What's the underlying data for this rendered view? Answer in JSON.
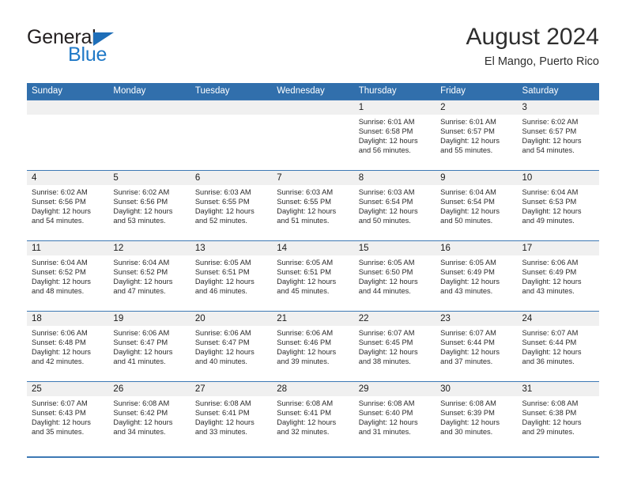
{
  "brand": {
    "name_part1": "General",
    "name_part2": "Blue",
    "accent_color": "#2079c7",
    "triangle_icon": "triangle-icon"
  },
  "header": {
    "month_title": "August 2024",
    "location": "El Mango, Puerto Rico"
  },
  "theme": {
    "header_band": "#316fac",
    "row_divider": "#3d79b4",
    "date_band": "#f0f0f0"
  },
  "weekdays": [
    "Sunday",
    "Monday",
    "Tuesday",
    "Wednesday",
    "Thursday",
    "Friday",
    "Saturday"
  ],
  "weeks": [
    [
      {
        "day": "",
        "empty": true
      },
      {
        "day": "",
        "empty": true
      },
      {
        "day": "",
        "empty": true
      },
      {
        "day": "",
        "empty": true
      },
      {
        "day": "1",
        "sunrise": "Sunrise: 6:01 AM",
        "sunset": "Sunset: 6:58 PM",
        "daylight1": "Daylight: 12 hours",
        "daylight2": "and 56 minutes."
      },
      {
        "day": "2",
        "sunrise": "Sunrise: 6:01 AM",
        "sunset": "Sunset: 6:57 PM",
        "daylight1": "Daylight: 12 hours",
        "daylight2": "and 55 minutes."
      },
      {
        "day": "3",
        "sunrise": "Sunrise: 6:02 AM",
        "sunset": "Sunset: 6:57 PM",
        "daylight1": "Daylight: 12 hours",
        "daylight2": "and 54 minutes."
      }
    ],
    [
      {
        "day": "4",
        "sunrise": "Sunrise: 6:02 AM",
        "sunset": "Sunset: 6:56 PM",
        "daylight1": "Daylight: 12 hours",
        "daylight2": "and 54 minutes."
      },
      {
        "day": "5",
        "sunrise": "Sunrise: 6:02 AM",
        "sunset": "Sunset: 6:56 PM",
        "daylight1": "Daylight: 12 hours",
        "daylight2": "and 53 minutes."
      },
      {
        "day": "6",
        "sunrise": "Sunrise: 6:03 AM",
        "sunset": "Sunset: 6:55 PM",
        "daylight1": "Daylight: 12 hours",
        "daylight2": "and 52 minutes."
      },
      {
        "day": "7",
        "sunrise": "Sunrise: 6:03 AM",
        "sunset": "Sunset: 6:55 PM",
        "daylight1": "Daylight: 12 hours",
        "daylight2": "and 51 minutes."
      },
      {
        "day": "8",
        "sunrise": "Sunrise: 6:03 AM",
        "sunset": "Sunset: 6:54 PM",
        "daylight1": "Daylight: 12 hours",
        "daylight2": "and 50 minutes."
      },
      {
        "day": "9",
        "sunrise": "Sunrise: 6:04 AM",
        "sunset": "Sunset: 6:54 PM",
        "daylight1": "Daylight: 12 hours",
        "daylight2": "and 50 minutes."
      },
      {
        "day": "10",
        "sunrise": "Sunrise: 6:04 AM",
        "sunset": "Sunset: 6:53 PM",
        "daylight1": "Daylight: 12 hours",
        "daylight2": "and 49 minutes."
      }
    ],
    [
      {
        "day": "11",
        "sunrise": "Sunrise: 6:04 AM",
        "sunset": "Sunset: 6:52 PM",
        "daylight1": "Daylight: 12 hours",
        "daylight2": "and 48 minutes."
      },
      {
        "day": "12",
        "sunrise": "Sunrise: 6:04 AM",
        "sunset": "Sunset: 6:52 PM",
        "daylight1": "Daylight: 12 hours",
        "daylight2": "and 47 minutes."
      },
      {
        "day": "13",
        "sunrise": "Sunrise: 6:05 AM",
        "sunset": "Sunset: 6:51 PM",
        "daylight1": "Daylight: 12 hours",
        "daylight2": "and 46 minutes."
      },
      {
        "day": "14",
        "sunrise": "Sunrise: 6:05 AM",
        "sunset": "Sunset: 6:51 PM",
        "daylight1": "Daylight: 12 hours",
        "daylight2": "and 45 minutes."
      },
      {
        "day": "15",
        "sunrise": "Sunrise: 6:05 AM",
        "sunset": "Sunset: 6:50 PM",
        "daylight1": "Daylight: 12 hours",
        "daylight2": "and 44 minutes."
      },
      {
        "day": "16",
        "sunrise": "Sunrise: 6:05 AM",
        "sunset": "Sunset: 6:49 PM",
        "daylight1": "Daylight: 12 hours",
        "daylight2": "and 43 minutes."
      },
      {
        "day": "17",
        "sunrise": "Sunrise: 6:06 AM",
        "sunset": "Sunset: 6:49 PM",
        "daylight1": "Daylight: 12 hours",
        "daylight2": "and 43 minutes."
      }
    ],
    [
      {
        "day": "18",
        "sunrise": "Sunrise: 6:06 AM",
        "sunset": "Sunset: 6:48 PM",
        "daylight1": "Daylight: 12 hours",
        "daylight2": "and 42 minutes."
      },
      {
        "day": "19",
        "sunrise": "Sunrise: 6:06 AM",
        "sunset": "Sunset: 6:47 PM",
        "daylight1": "Daylight: 12 hours",
        "daylight2": "and 41 minutes."
      },
      {
        "day": "20",
        "sunrise": "Sunrise: 6:06 AM",
        "sunset": "Sunset: 6:47 PM",
        "daylight1": "Daylight: 12 hours",
        "daylight2": "and 40 minutes."
      },
      {
        "day": "21",
        "sunrise": "Sunrise: 6:06 AM",
        "sunset": "Sunset: 6:46 PM",
        "daylight1": "Daylight: 12 hours",
        "daylight2": "and 39 minutes."
      },
      {
        "day": "22",
        "sunrise": "Sunrise: 6:07 AM",
        "sunset": "Sunset: 6:45 PM",
        "daylight1": "Daylight: 12 hours",
        "daylight2": "and 38 minutes."
      },
      {
        "day": "23",
        "sunrise": "Sunrise: 6:07 AM",
        "sunset": "Sunset: 6:44 PM",
        "daylight1": "Daylight: 12 hours",
        "daylight2": "and 37 minutes."
      },
      {
        "day": "24",
        "sunrise": "Sunrise: 6:07 AM",
        "sunset": "Sunset: 6:44 PM",
        "daylight1": "Daylight: 12 hours",
        "daylight2": "and 36 minutes."
      }
    ],
    [
      {
        "day": "25",
        "sunrise": "Sunrise: 6:07 AM",
        "sunset": "Sunset: 6:43 PM",
        "daylight1": "Daylight: 12 hours",
        "daylight2": "and 35 minutes."
      },
      {
        "day": "26",
        "sunrise": "Sunrise: 6:08 AM",
        "sunset": "Sunset: 6:42 PM",
        "daylight1": "Daylight: 12 hours",
        "daylight2": "and 34 minutes."
      },
      {
        "day": "27",
        "sunrise": "Sunrise: 6:08 AM",
        "sunset": "Sunset: 6:41 PM",
        "daylight1": "Daylight: 12 hours",
        "daylight2": "and 33 minutes."
      },
      {
        "day": "28",
        "sunrise": "Sunrise: 6:08 AM",
        "sunset": "Sunset: 6:41 PM",
        "daylight1": "Daylight: 12 hours",
        "daylight2": "and 32 minutes."
      },
      {
        "day": "29",
        "sunrise": "Sunrise: 6:08 AM",
        "sunset": "Sunset: 6:40 PM",
        "daylight1": "Daylight: 12 hours",
        "daylight2": "and 31 minutes."
      },
      {
        "day": "30",
        "sunrise": "Sunrise: 6:08 AM",
        "sunset": "Sunset: 6:39 PM",
        "daylight1": "Daylight: 12 hours",
        "daylight2": "and 30 minutes."
      },
      {
        "day": "31",
        "sunrise": "Sunrise: 6:08 AM",
        "sunset": "Sunset: 6:38 PM",
        "daylight1": "Daylight: 12 hours",
        "daylight2": "and 29 minutes."
      }
    ]
  ]
}
